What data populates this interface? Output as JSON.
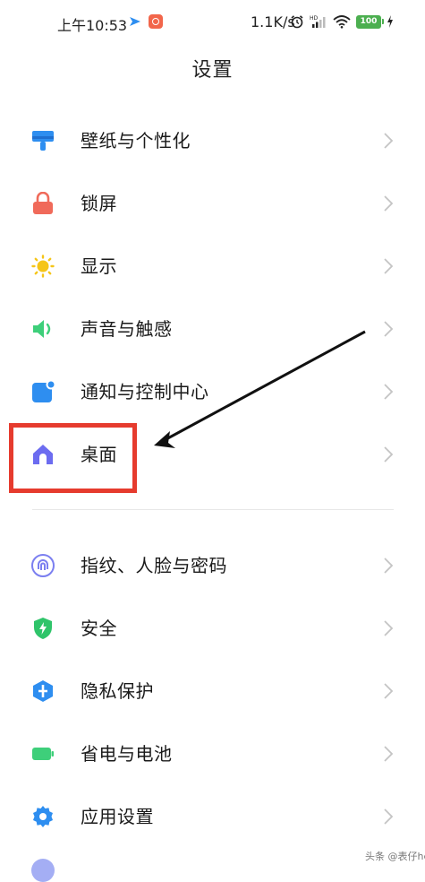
{
  "status_bar": {
    "time": "上午10:53",
    "net_speed": "1.1K/s",
    "battery": "100",
    "hd_label": "HD"
  },
  "header": {
    "title": "设置"
  },
  "settings_items": [
    {
      "label": "壁纸与个性化",
      "icon": "wallpaper-icon"
    },
    {
      "label": "锁屏",
      "icon": "lock-icon"
    },
    {
      "label": "显示",
      "icon": "sun-icon"
    },
    {
      "label": "声音与触感",
      "icon": "speaker-icon"
    },
    {
      "label": "通知与控制中心",
      "icon": "notification-icon"
    },
    {
      "label": "桌面",
      "icon": "home-icon"
    },
    {
      "label": "指纹、人脸与密码",
      "icon": "fingerprint-icon"
    },
    {
      "label": "安全",
      "icon": "shield-icon"
    },
    {
      "label": "隐私保护",
      "icon": "privacy-icon"
    },
    {
      "label": "省电与电池",
      "icon": "battery-icon"
    },
    {
      "label": "应用设置",
      "icon": "gear-icon"
    }
  ],
  "annotation": {
    "highlighted_item": "桌面",
    "highlight_color": "#e63b2e"
  },
  "watermark": "头条 @表仔he",
  "colors": {
    "wallpaper": "#2e8ef0",
    "lock": "#f06a5a",
    "sun": "#f5c518",
    "speaker": "#3ecf7a",
    "notification": "#2e8ef0",
    "home": "#6c6cf0",
    "fingerprint": "#7b7ff0",
    "shield": "#2fc46a",
    "privacy": "#2e8ef0",
    "battery_icon": "#3ecf7a",
    "gear": "#2e8ef0"
  }
}
